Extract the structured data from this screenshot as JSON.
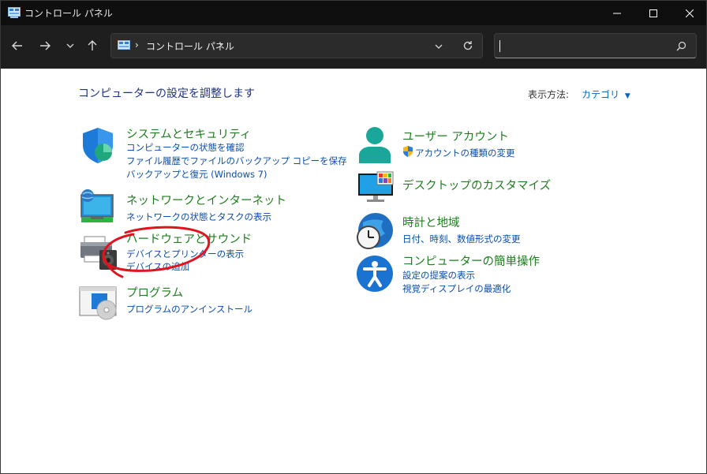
{
  "window": {
    "title": "コントロール パネル"
  },
  "address": {
    "breadcrumb_root": "コントロール パネル",
    "separator": "›"
  },
  "search": {
    "value": "",
    "placeholder": ""
  },
  "main": {
    "heading": "コンピューターの設定を調整します",
    "view_by_label": "表示方法:",
    "view_by_value": "カテゴリ"
  },
  "categories": {
    "system_security": {
      "title": "システムとセキュリティ",
      "links": [
        "コンピューターの状態を確認",
        "ファイル履歴でファイルのバックアップ コピーを保存",
        "バックアップと復元 (Windows 7)"
      ]
    },
    "network": {
      "title": "ネットワークとインターネット",
      "links": [
        "ネットワークの状態とタスクの表示"
      ]
    },
    "hardware": {
      "title": "ハードウェアとサウンド",
      "links": [
        "デバイスとプリンターの表示",
        "デバイスの追加"
      ]
    },
    "programs": {
      "title": "プログラム",
      "links": [
        "プログラムのアンインストール"
      ]
    },
    "user_accounts": {
      "title": "ユーザー アカウント",
      "links": [
        "アカウントの種類の変更"
      ]
    },
    "appearance": {
      "title": "デスクトップのカスタマイズ",
      "links": []
    },
    "clock_region": {
      "title": "時計と地域",
      "links": [
        "日付、時刻、数値形式の変更"
      ]
    },
    "ease_of_access": {
      "title": "コンピューターの簡単操作",
      "links": [
        "設定の提案の表示",
        "視覚ディスプレイの最適化"
      ]
    }
  },
  "colors": {
    "title_green": "#1e7e1e",
    "link_blue": "#0a4dab",
    "heading_blue": "#1e3287",
    "annotation_red": "#e0141e"
  }
}
